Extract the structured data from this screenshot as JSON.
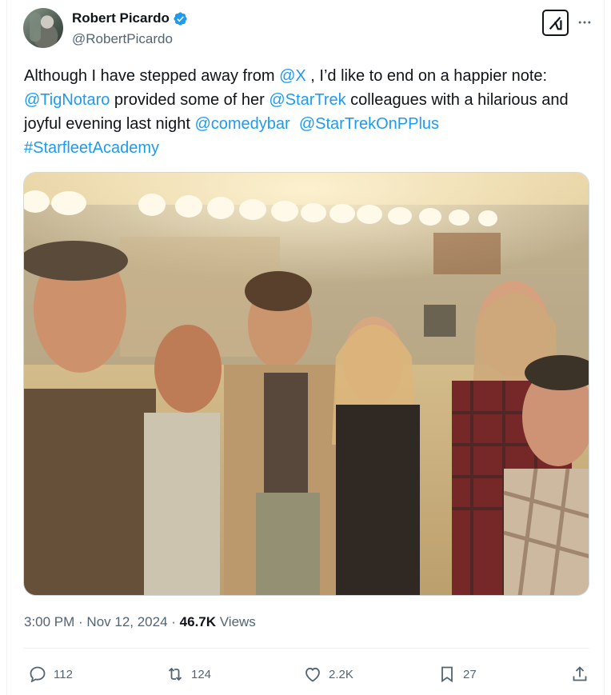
{
  "author": {
    "display_name": "Robert Picardo",
    "handle": "@RobertPicardo",
    "avatar_icon": "avatar",
    "verified_icon": "verified-badge-icon"
  },
  "tweet": {
    "segments": [
      {
        "text": "Although I have stepped away from ",
        "link": false
      },
      {
        "text": "@X",
        "link": true
      },
      {
        "text": " , I’d like to end on a happier note:",
        "link": false
      },
      {
        "text": "\n",
        "link": false
      },
      {
        "text": "@TigNotaro",
        "link": true
      },
      {
        "text": " provided some of her ",
        "link": false
      },
      {
        "text": "@StarTrek",
        "link": true
      },
      {
        "text": " colleagues with a hilarious and joyful evening last night ",
        "link": false
      },
      {
        "text": "@comedybar",
        "link": true
      },
      {
        "text": "  ",
        "link": false
      },
      {
        "text": "@StarTrekOnPPlus",
        "link": true
      },
      {
        "text": "\n",
        "link": false
      },
      {
        "text": "#StarfleetAcademy",
        "link": true
      }
    ]
  },
  "meta": {
    "time": "3:00 PM",
    "sep1": " · ",
    "date": "Nov 12, 2024",
    "sep2": " · ",
    "views_count": "46.7K",
    "views_label": " Views"
  },
  "actions": {
    "replies": "112",
    "reposts": "124",
    "likes": "2.2K",
    "bookmarks": "27"
  },
  "colors": {
    "link": "#1d9bf0",
    "text": "#0f1419",
    "muted": "#536471",
    "verified": "#1d9bf0"
  }
}
